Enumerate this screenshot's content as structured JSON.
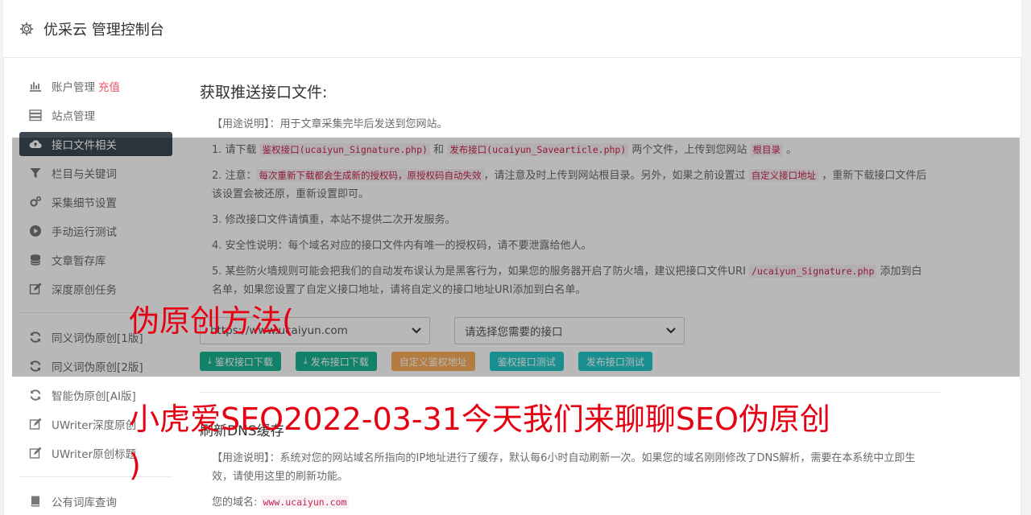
{
  "header": {
    "title": "优采云 管理控制台"
  },
  "sidebar": {
    "items": [
      {
        "label": "账户管理",
        "extra": "充值",
        "icon": "bar-chart-icon"
      },
      {
        "label": "站点管理",
        "icon": "server-icon"
      },
      {
        "label": "接口文件相关",
        "icon": "cloud-upload-icon",
        "active": true
      },
      {
        "label": "栏目与关键词",
        "icon": "filter-icon"
      },
      {
        "label": "采集细节设置",
        "icon": "cogs-icon"
      },
      {
        "label": "手动运行测试",
        "icon": "play-circle-icon"
      },
      {
        "label": "文章暂存库",
        "icon": "database-icon"
      },
      {
        "label": "深度原创任务",
        "icon": "edit-icon"
      },
      {
        "label": "同义词伪原创[1版]",
        "icon": "refresh-icon"
      },
      {
        "label": "同义词伪原创[2版]",
        "icon": "refresh-icon"
      },
      {
        "label": "智能伪原创[AI版]",
        "icon": "refresh-icon"
      },
      {
        "label": "UWriter深度原创",
        "icon": "edit-icon"
      },
      {
        "label": "UWriter原创标题",
        "icon": "edit-icon"
      },
      {
        "label": "公有词库查询",
        "icon": "book-icon"
      }
    ]
  },
  "main": {
    "title": "获取推送接口文件:",
    "usage": "【用途说明】：用于文章采集完毕后发送到您网站。",
    "step1": {
      "a": "1. 请下载 ",
      "code1": "鉴权接口(ucaiyun_Signature.php)",
      "b": " 和 ",
      "code2": "发布接口(ucaiyun_Savearticle.php)",
      "c": " 两个文件，上传到您网站 ",
      "code3": "根目录",
      "d": " 。"
    },
    "step2": {
      "a": "2. 注意：",
      "code1": "每次重新下载都会生成新的授权码，原授权码自动失效",
      "b": "，请注意及时上传到网站根目录。另外，如果之前设置过 ",
      "code2": "自定义接口地址",
      "c": " ，重新下载接口文件后该设置会被还原，重新设置即可。"
    },
    "step3": "3. 修改接口文件请慎重，本站不提供二次开发服务。",
    "step4": "4. 安全性说明：每个域名对应的接口文件内有唯一的授权码，请不要泄露给他人。",
    "step5": {
      "a": "5. 某些防火墙规则可能会把我们的自动发布误认为是黑客行为，如果您的服务器开启了防火墙，建议把接口文件URI ",
      "code1": "/ucaiyun_Signature.php",
      "b": " 添加到白名单，如果您设置了自定义接口地址，请将自定义的接口地址URI添加到白名单。"
    },
    "site_select": "https://www.ucaiyun.com",
    "interface_select": "请选择您需要的接口",
    "buttons": {
      "auth_download": "鉴权接口下载",
      "publish_download": "发布接口下载",
      "custom_auth": "自定义鉴权地址",
      "auth_test": "鉴权接口测试",
      "publish_test": "发布接口测试"
    },
    "dns_title": "刷新DNS缓存",
    "dns_usage": "【用途说明】：系统对您的网站域名所指向的IP地址进行了缓存，默认每6小时自动刷新一次。如果您的域名刚刚修改了DNS解析，需要在本系统中立即生效，请使用这里的刷新功能。",
    "domain_label": "您的域名:",
    "domain_value": "www.ucaiyun.com"
  },
  "watermark": {
    "line1": "伪原创方法(",
    "line2": "小虎爱SEO2022-03-31今天我们来聊聊SEO伪原创",
    "line3": ")"
  },
  "colors": {
    "watermark": "#e60012",
    "active_nav": "#3e4852",
    "code": "#c7254e",
    "recharge": "#ed5565"
  }
}
